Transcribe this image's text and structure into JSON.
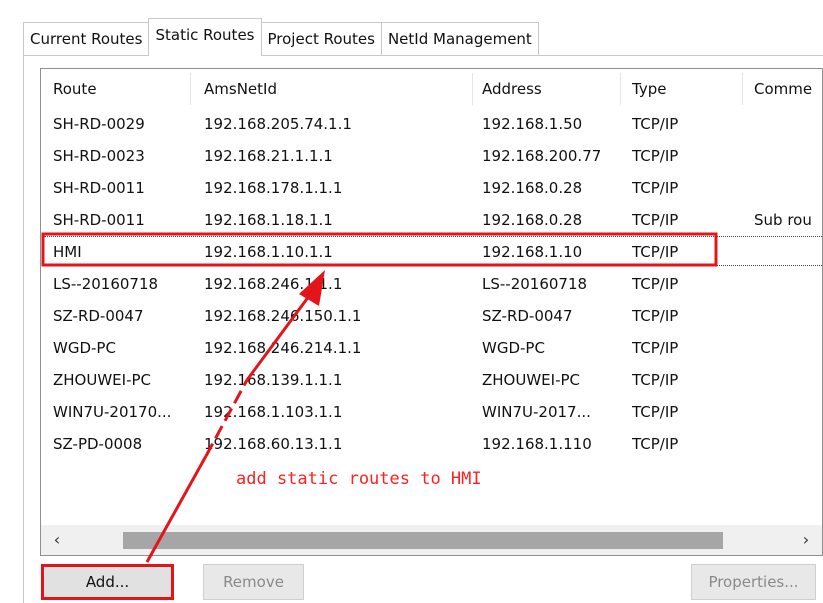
{
  "tabs": [
    {
      "label": "Current Routes"
    },
    {
      "label": "Static Routes"
    },
    {
      "label": "Project Routes"
    },
    {
      "label": "NetId Management"
    }
  ],
  "table": {
    "columns": [
      "Route",
      "AmsNetId",
      "Address",
      "Type",
      "Comme"
    ],
    "rows": [
      [
        "SH-RD-0029",
        "192.168.205.74.1.1",
        "192.168.1.50",
        "TCP/IP",
        ""
      ],
      [
        "SH-RD-0023",
        "192.168.21.1.1.1",
        "192.168.200.77",
        "TCP/IP",
        ""
      ],
      [
        "SH-RD-0011",
        "192.168.178.1.1.1",
        "192.168.0.28",
        "TCP/IP",
        ""
      ],
      [
        "SH-RD-0011",
        "192.168.1.18.1.1",
        "192.168.0.28",
        "TCP/IP",
        "Sub rou"
      ],
      [
        "HMI",
        "192.168.1.10.1.1",
        "192.168.1.10",
        "TCP/IP",
        ""
      ],
      [
        "LS--20160718",
        "192.168.246.1.1.1",
        "LS--20160718",
        "TCP/IP",
        ""
      ],
      [
        "SZ-RD-0047",
        "192.168.246.150.1.1",
        "SZ-RD-0047",
        "TCP/IP",
        ""
      ],
      [
        "WGD-PC",
        "192.168.246.214.1.1",
        "WGD-PC",
        "TCP/IP",
        ""
      ],
      [
        "ZHOUWEI-PC",
        "192.168.139.1.1.1",
        "ZHOUWEI-PC",
        "TCP/IP",
        ""
      ],
      [
        "WIN7U-20170...",
        "192.168.1.103.1.1",
        "WIN7U-2017...",
        "TCP/IP",
        ""
      ],
      [
        "SZ-PD-0008",
        "192.168.60.13.1.1",
        "192.168.1.110",
        "TCP/IP",
        ""
      ]
    ]
  },
  "scrollbar": {
    "left_arrow": "‹",
    "right_arrow": "›"
  },
  "annotation": {
    "text": "add static routes to HMI",
    "color": "#ff2020"
  },
  "buttons": {
    "add": "Add...",
    "remove": "Remove",
    "properties": "Properties..."
  },
  "highlight_color": "#e4141b"
}
